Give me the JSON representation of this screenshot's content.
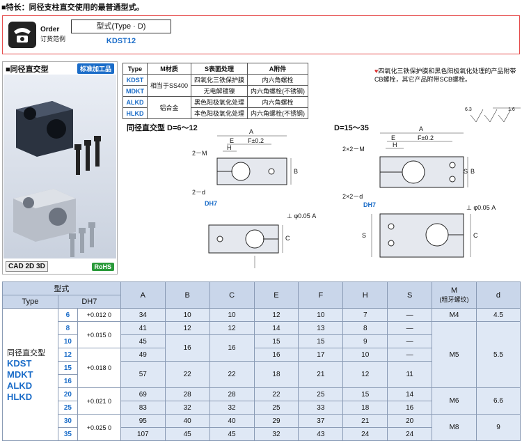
{
  "header": {
    "feature_text": "■特长：同径支柱直交使用的最普通型式。"
  },
  "order": {
    "label_en": "Order",
    "label_cn": "订货范例",
    "type_heading": "型式(Type · D)",
    "type_value": "KDST12"
  },
  "left_panel": {
    "title": "■同径直交型",
    "badge": "标准加工品",
    "cad": "CAD 2D 3D",
    "rohs": "RoHS"
  },
  "spec_table": {
    "headers": [
      "Type",
      "M材质",
      "S表面处理",
      "A附件"
    ],
    "rows": [
      {
        "type": "KDST",
        "material": "相当于SS400",
        "surface": "四氧化三铁保护膜",
        "accessory": "内六角螺栓"
      },
      {
        "type": "MDKT",
        "material": "",
        "surface": "无电解镀镍",
        "accessory": "内六角螺栓(不锈钢)"
      },
      {
        "type": "ALKD",
        "material": "铝合金",
        "surface": "黑色阳极氧化处理",
        "accessory": "内六角螺栓"
      },
      {
        "type": "HLKD",
        "material": "",
        "surface": "本色阳极氧化处理",
        "accessory": "内六角螺栓(不锈钢)"
      }
    ]
  },
  "note": {
    "mark": "♥",
    "text": "四氧化三铁保护膜和黑色阳极氧化处理的产品附带CB螺栓，其它产品附带SCB螺栓。"
  },
  "drawing": {
    "title_small": "同径直交型  D=6～12",
    "title_large": "D=15～35",
    "labels": [
      "A",
      "E",
      "F±0.2",
      "H",
      "2－M",
      "2－d",
      "DH7",
      "B",
      "S",
      "C",
      "2×2－M",
      "2×2－d",
      "⊥ φ0.05 A",
      "6.3",
      "1.6"
    ]
  },
  "main_table": {
    "header_row1": [
      "型式",
      "A",
      "B",
      "C",
      "E",
      "F",
      "H",
      "S",
      "M",
      "d"
    ],
    "m_sub": "(粗牙螺纹)",
    "header_row2": [
      "Type",
      "DH7"
    ],
    "type_names": {
      "cn": "同径直交型",
      "codes": [
        "KDST",
        "MDKT",
        "ALKD",
        "HLKD"
      ]
    },
    "rows": [
      {
        "D": "6",
        "A": "34",
        "B": "10",
        "C": "10",
        "E": "12",
        "F": "10",
        "H": "7",
        "S": "—"
      },
      {
        "D": "8",
        "A": "41",
        "B": "12",
        "C": "12",
        "E": "14",
        "F": "13",
        "H": "8",
        "S": "—"
      },
      {
        "D": "10",
        "A": "45",
        "B": "",
        "C": "",
        "E": "15",
        "F": "15",
        "H": "9",
        "S": "—"
      },
      {
        "D": "12",
        "A": "49",
        "B": "",
        "C": "",
        "E": "16",
        "F": "17",
        "H": "10",
        "S": "—"
      },
      {
        "D": "15",
        "A": "57",
        "B": "22",
        "C": "22",
        "E": "18",
        "F": "21",
        "H": "12",
        "S": "11"
      },
      {
        "D": "16",
        "A": "",
        "B": "",
        "C": "",
        "E": "",
        "F": "",
        "H": "",
        "S": ""
      },
      {
        "D": "20",
        "A": "69",
        "B": "28",
        "C": "28",
        "E": "22",
        "F": "25",
        "H": "15",
        "S": "14"
      },
      {
        "D": "25",
        "A": "83",
        "B": "32",
        "C": "32",
        "E": "25",
        "F": "33",
        "H": "18",
        "S": "16"
      },
      {
        "D": "30",
        "A": "95",
        "B": "40",
        "C": "40",
        "E": "29",
        "F": "37",
        "H": "21",
        "S": "20"
      },
      {
        "D": "35",
        "A": "107",
        "B": "45",
        "C": "45",
        "E": "32",
        "F": "43",
        "H": "24",
        "S": "24"
      }
    ],
    "b_merged_10_12": "16",
    "c_merged_10_12": "16",
    "tol": {
      "t6": "+0.012 0",
      "t8_10": "+0.015 0",
      "t12_16": "+0.018 0",
      "t20_25": "+0.021 0",
      "t30_35": "+0.025 0"
    },
    "M": {
      "m6": "M4",
      "m8_16": "M5",
      "m20_25": "M6",
      "m30_35": "M8"
    },
    "d": {
      "d6": "4.5",
      "d8_16": "5.5",
      "d20_25": "6.6",
      "d30_35": "9"
    }
  }
}
